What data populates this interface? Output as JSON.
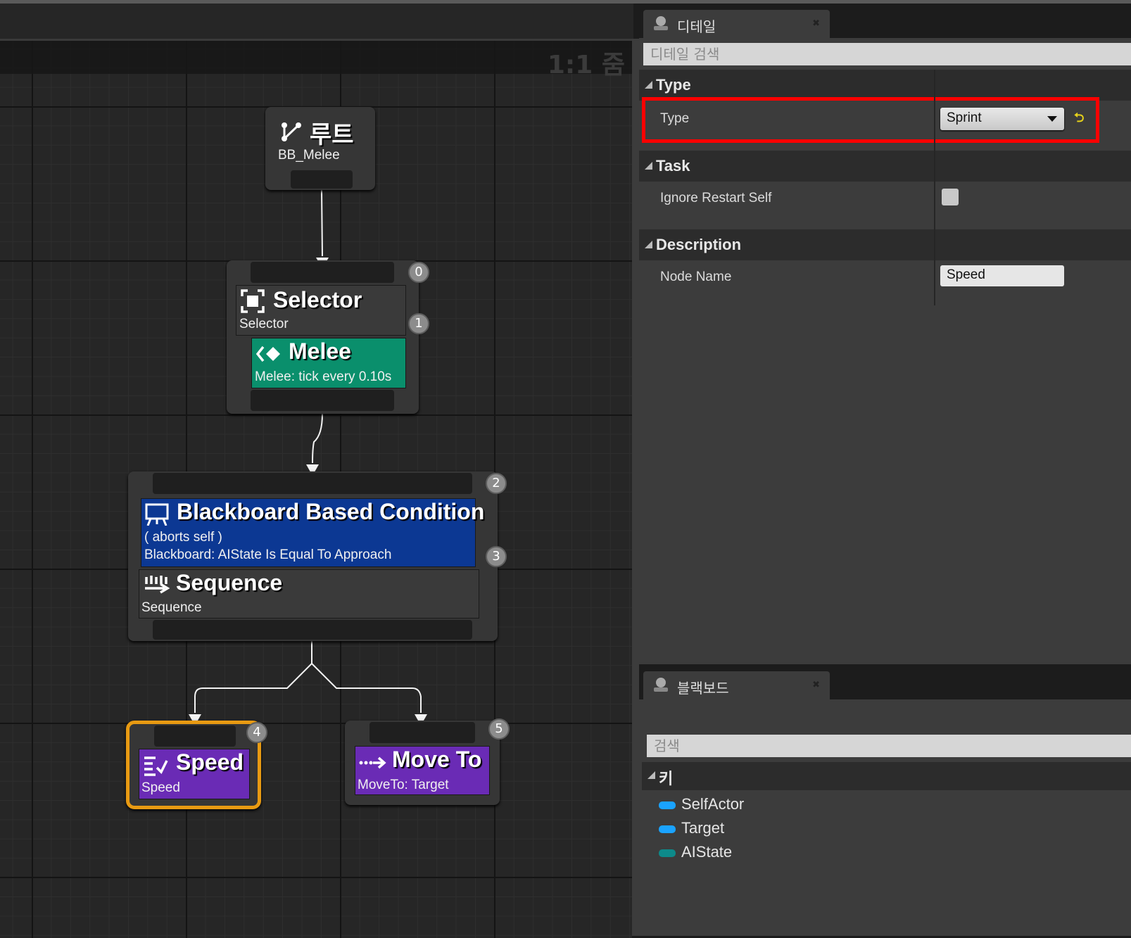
{
  "graph": {
    "zoom_label": "1:1 줌",
    "root": {
      "title": "루트",
      "subtitle": "BB_Melee"
    },
    "selector": {
      "title": "Selector",
      "subtitle": "Selector",
      "index_top": "0",
      "index_side": "1"
    },
    "melee": {
      "title": "Melee",
      "subtitle": "Melee: tick every 0.10s",
      "color": "#0a8f6c"
    },
    "sequence_group": {
      "index_top": "2",
      "index_side": "3",
      "decorator": {
        "title": "Blackboard Based Condition",
        "line1": "( aborts self )",
        "line2": "Blackboard: AIState Is Equal To Approach",
        "color": "#0c3893"
      },
      "sequence": {
        "title": "Sequence",
        "subtitle": "Sequence"
      }
    },
    "speed_task": {
      "title": "Speed",
      "subtitle": "Speed",
      "index": "4",
      "color": "#6a2bb5",
      "selected_color": "#e89a12"
    },
    "moveto_task": {
      "title": "Move To",
      "subtitle": "MoveTo: Target",
      "index": "5",
      "color": "#6a2bb5"
    }
  },
  "details": {
    "tab_label": "디테일",
    "search_placeholder": "디테일 검색",
    "categories": [
      {
        "label": "Type",
        "property": "Type",
        "value": "Sprint"
      },
      {
        "label": "Task",
        "property": "Ignore Restart Self",
        "checked": false
      },
      {
        "label": "Description",
        "property": "Node Name",
        "value": "Speed"
      }
    ],
    "highlight_color": "#ff0000"
  },
  "blackboard": {
    "tab_label": "블랙보드",
    "search_placeholder": "검색",
    "keys_category": "키",
    "keys": [
      {
        "name": "SelfActor",
        "color": "#1aa3ff"
      },
      {
        "name": "Target",
        "color": "#1aa3ff"
      },
      {
        "name": "AIState",
        "color": "#0d8a8a"
      }
    ]
  }
}
